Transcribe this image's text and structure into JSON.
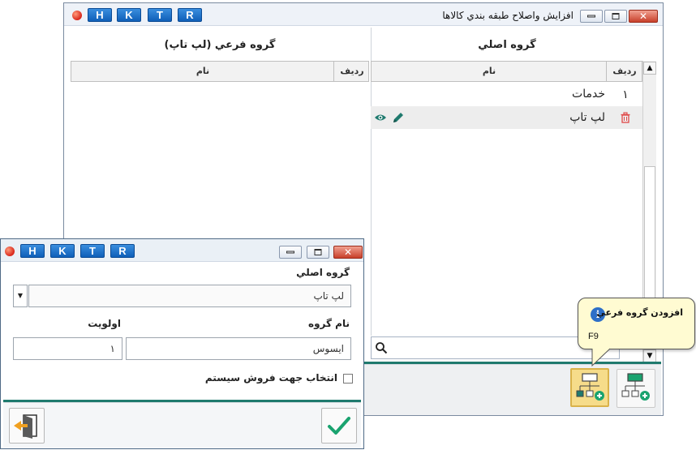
{
  "main_window": {
    "title": "افزايش واصلاح طبقه بندي كالاها",
    "hotkeys": [
      "H",
      "K",
      "T",
      "R"
    ],
    "close_glyph": "✕",
    "right_panel": {
      "title": "گروه اصلي",
      "col_index": "رديف",
      "col_name": "نام",
      "rows": [
        {
          "index": "١",
          "name": "خدمات"
        },
        {
          "index": "",
          "name": "لپ تاپ"
        }
      ]
    },
    "left_panel": {
      "title": "گروه فرعي (لپ تاپ)",
      "col_index": "رديف",
      "col_name": "نام"
    },
    "search": {
      "value": "",
      "placeholder": ""
    },
    "scroll_up": "▲",
    "scroll_down": "▼"
  },
  "tooltip": {
    "title": "افزودن گروه فرعي",
    "shortcut": "F9",
    "icon": "i"
  },
  "dialog": {
    "hotkeys": [
      "H",
      "K",
      "T",
      "R"
    ],
    "close_glyph": "✕",
    "main_group_label": "گروه اصلي",
    "main_group_value": "لپ تاپ",
    "dropdown_arrow": "▼",
    "group_name_label": "نام گروه",
    "group_name_value": "ايسوس",
    "priority_label": "اولويت",
    "priority_value": "١",
    "checkbox_label": "انتخاب جهت فروش سيستم",
    "checkbox_checked": false
  },
  "colors": {
    "accent_teal": "#1f7a6e",
    "confirm_green": "#1aa36f",
    "exit_orange": "#f0a020",
    "delete_red": "#e04848",
    "tooltip_bg": "#fffbd2"
  },
  "icons": [
    "apple-icon",
    "minimize-icon",
    "maximize-icon",
    "close-icon",
    "delete-icon",
    "view-icon",
    "edit-icon",
    "search-icon",
    "add-subgroup-icon",
    "add-group-icon",
    "info-icon",
    "confirm-icon",
    "exit-icon"
  ]
}
